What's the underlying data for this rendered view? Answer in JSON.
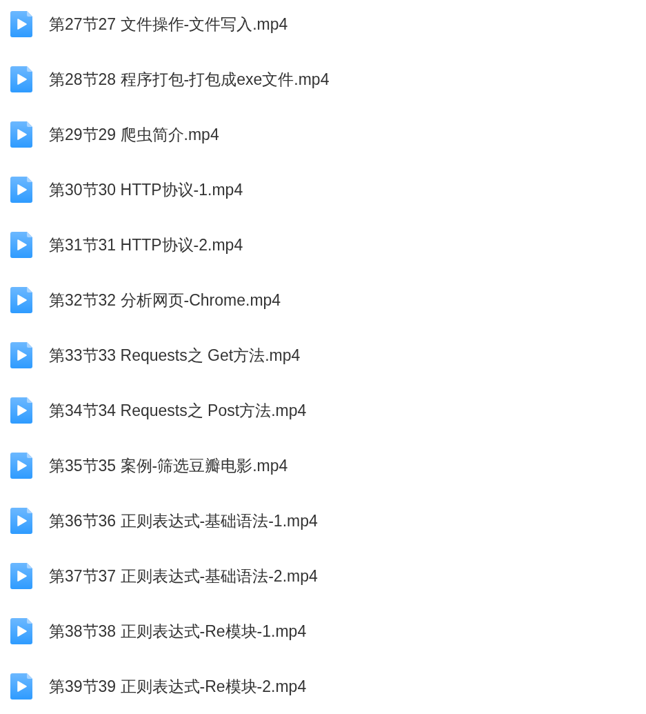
{
  "files": [
    {
      "name": "第27节27 文件操作-文件写入.mp4"
    },
    {
      "name": "第28节28 程序打包-打包成exe文件.mp4"
    },
    {
      "name": "第29节29 爬虫简介.mp4"
    },
    {
      "name": "第30节30 HTTP协议-1.mp4"
    },
    {
      "name": "第31节31 HTTP协议-2.mp4"
    },
    {
      "name": "第32节32 分析网页-Chrome.mp4"
    },
    {
      "name": "第33节33 Requests之 Get方法.mp4"
    },
    {
      "name": "第34节34 Requests之 Post方法.mp4"
    },
    {
      "name": "第35节35 案例-筛选豆瓣电影.mp4"
    },
    {
      "name": "第36节36 正则表达式-基础语法-1.mp4"
    },
    {
      "name": "第37节37 正则表达式-基础语法-2.mp4"
    },
    {
      "name": "第38节38 正则表达式-Re模块-1.mp4"
    },
    {
      "name": "第39节39 正则表达式-Re模块-2.mp4"
    }
  ]
}
